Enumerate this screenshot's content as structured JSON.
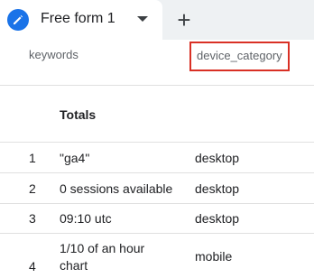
{
  "tabbar": {
    "tab": {
      "label": "Free form 1",
      "icon": "pencil-icon"
    },
    "add_label": "+"
  },
  "table": {
    "headers": {
      "keywords": "keywords",
      "device": "device_category"
    },
    "totals_label": "Totals",
    "rows": [
      {
        "index": "1",
        "keyword": "\"ga4\"",
        "device": "desktop"
      },
      {
        "index": "2",
        "keyword": "0 sessions available",
        "device": "desktop"
      },
      {
        "index": "3",
        "keyword": "09:10 utc",
        "device": "desktop"
      },
      {
        "index": "4",
        "keyword": "1/10 of an hour",
        "keyword_line2": "chart",
        "device": "mobile"
      }
    ]
  },
  "colors": {
    "accent": "#1a73e8",
    "highlight": "#d93025"
  }
}
